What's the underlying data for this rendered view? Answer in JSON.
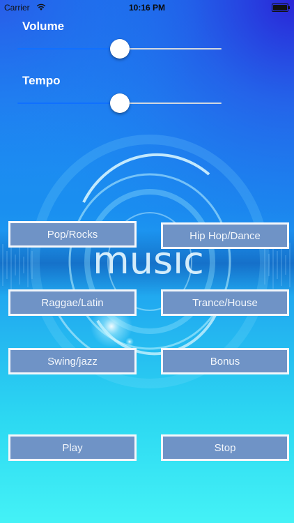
{
  "status_bar": {
    "carrier": "Carrier",
    "time": "10:16 PM"
  },
  "art": {
    "word": "music"
  },
  "sliders": {
    "volume": {
      "label": "Volume",
      "value": 0.5
    },
    "tempo": {
      "label": "Tempo",
      "value": 0.5
    }
  },
  "genres": {
    "pop_rocks": "Pop/Rocks",
    "hiphop_dance": "Hip Hop/Dance",
    "raggae_latin": "Raggae/Latin",
    "trance_house": "Trance/House",
    "swing_jazz": "Swing/jazz",
    "bonus": "Bonus"
  },
  "controls": {
    "play": "Play",
    "stop": "Stop"
  }
}
